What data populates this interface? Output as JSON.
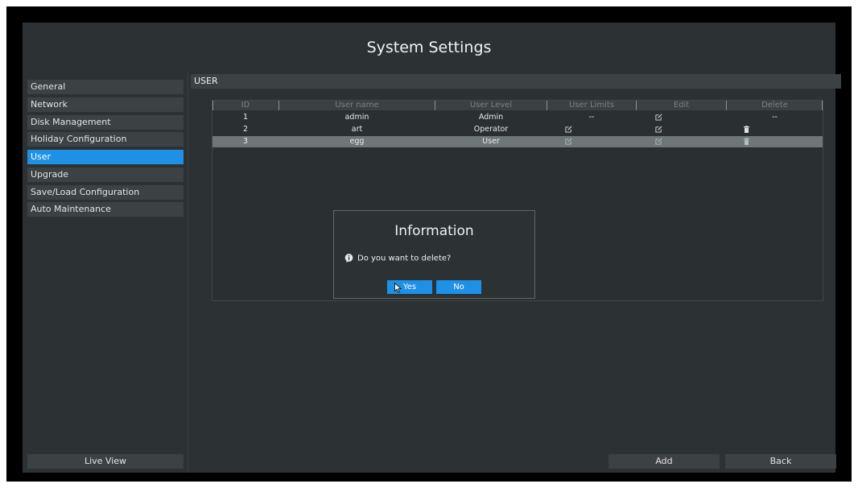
{
  "header": {
    "title": "System Settings"
  },
  "sidebar": {
    "items": [
      {
        "label": "General",
        "active": false
      },
      {
        "label": "Network",
        "active": false
      },
      {
        "label": "Disk Management",
        "active": false
      },
      {
        "label": "Holiday Configuration",
        "active": false
      },
      {
        "label": "User",
        "active": true
      },
      {
        "label": "Upgrade",
        "active": false
      },
      {
        "label": "Save/Load Configuration",
        "active": false
      },
      {
        "label": "Auto Maintenance",
        "active": false
      }
    ],
    "live_view_label": "Live View"
  },
  "section": {
    "title": "USER"
  },
  "table": {
    "columns": [
      "ID",
      "User name",
      "User Level",
      "User Limits",
      "Edit",
      "Delete"
    ],
    "rows": [
      {
        "id": "1",
        "name": "admin",
        "level": "Admin",
        "limits": "--",
        "edit": "edit-icon",
        "delete": "--",
        "selected": false
      },
      {
        "id": "2",
        "name": "art",
        "level": "Operator",
        "limits": "edit-icon",
        "edit": "edit-icon",
        "delete": "trash-icon",
        "selected": false
      },
      {
        "id": "3",
        "name": "egg",
        "level": "User",
        "limits": "edit-icon",
        "edit": "edit-icon",
        "delete": "trash-icon",
        "selected": true
      }
    ]
  },
  "dialog": {
    "title": "Information",
    "message": "Do you want to delete?",
    "icon": "info-icon",
    "yes_label": "Yes",
    "no_label": "No"
  },
  "footer": {
    "add_label": "Add",
    "back_label": "Back"
  },
  "colors": {
    "accent": "#1e90e6",
    "background": "#2c3133",
    "item": "#3c4143",
    "selected_row": "#6f7678"
  }
}
